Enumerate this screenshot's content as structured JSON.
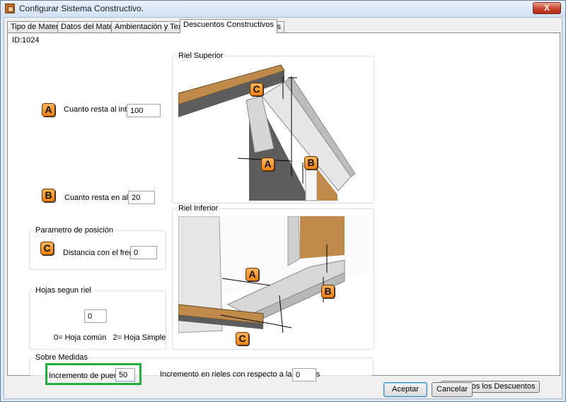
{
  "window": {
    "title": "Configurar Sistema Constructivo.",
    "close_glyph": "X"
  },
  "tabs": [
    {
      "label": "Tipo de Material"
    },
    {
      "label": "Datos del Material"
    },
    {
      "label": "Ambientación y Texturas"
    },
    {
      "label": "Descuentos Constructivos"
    },
    {
      "label": "Filtros"
    }
  ],
  "active_tab": "Descuentos Constructivos",
  "panel": {
    "id_label": "ID:1024",
    "field_a": {
      "badge": "A",
      "label": "Cuanto resta al interior",
      "value": "100"
    },
    "field_b": {
      "badge": "B",
      "label": "Cuanto resta en altura",
      "value": "20"
    },
    "posicion": {
      "title": "Parametro de posición",
      "badge": "C",
      "label": "Distancia con el frente",
      "value": "0"
    },
    "hojas": {
      "title": "Hojas segun riel",
      "value": "0",
      "hint": "0= Hoja común   2= Hoja Simple"
    },
    "riel_superior": {
      "title": "Riel Superior",
      "badge_c": "C",
      "badge_a": "A",
      "badge_b": "B"
    },
    "riel_inferior": {
      "title": "Riel Inferior",
      "badge_a": "A",
      "badge_b": "B",
      "badge_c": "C"
    },
    "sobre_medidas": {
      "title": "Sobre Medidas",
      "puertas_label": "Incremento de puertas",
      "puertas_value": "50",
      "rieles_label": "Incremento en rieles con respecto a la puertas",
      "rieles_value": "0"
    },
    "ver_todos_button": "Ver Todos los Descuentos"
  },
  "footer": {
    "accept_button": "Aceptar",
    "cancel_button": "Cancelar"
  },
  "colors": {
    "badge": "#ee8010",
    "highlight": "#21b03b",
    "wood": "#c08b4a",
    "wall": "#5d5d5d"
  }
}
